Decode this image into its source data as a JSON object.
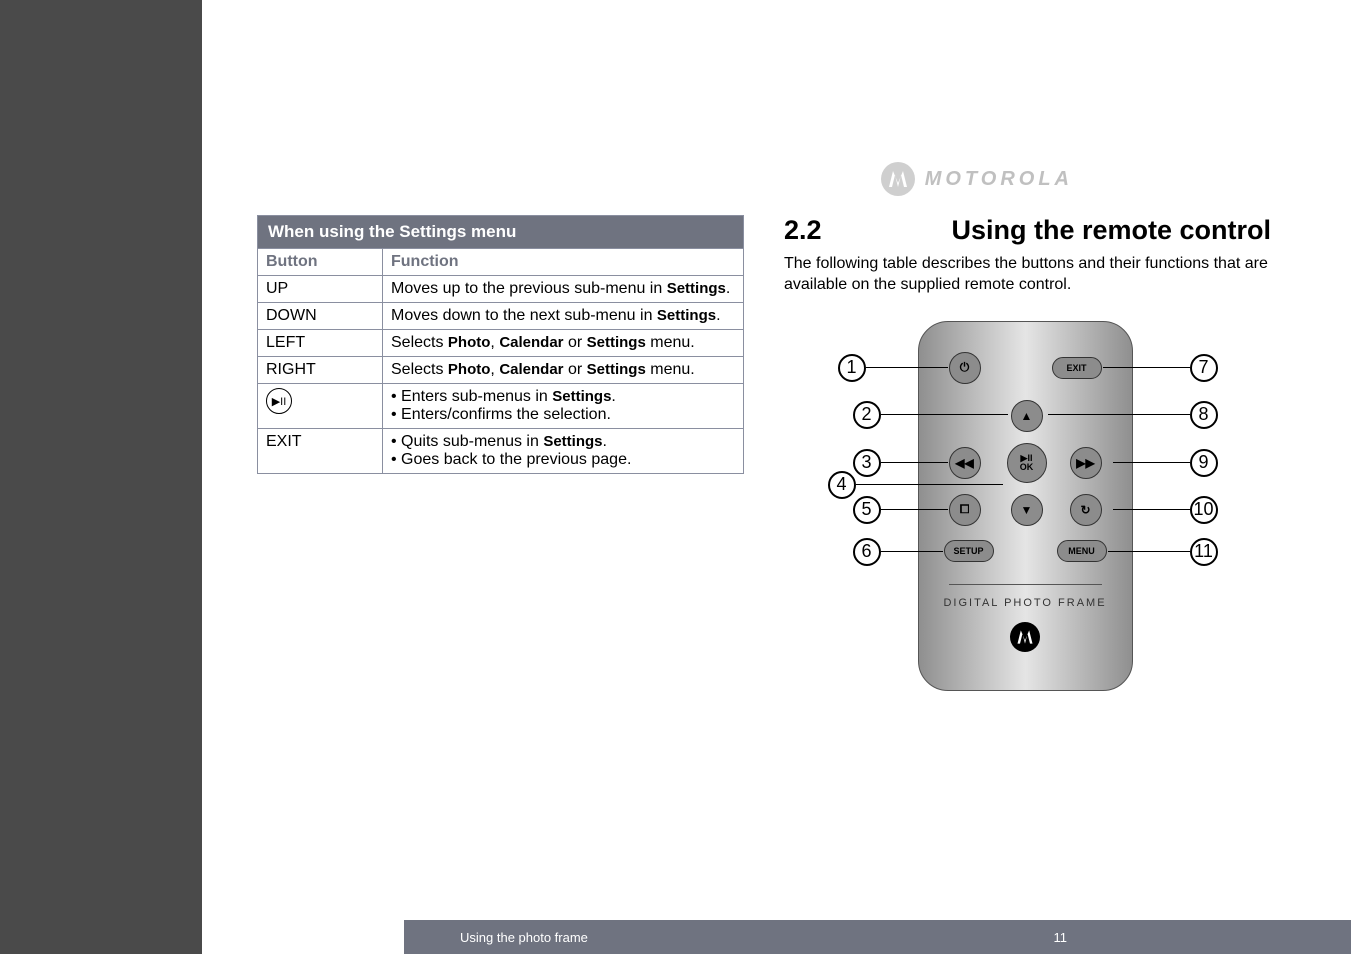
{
  "brand": "MOTOROLA",
  "header": {
    "section_number": "2.2",
    "section_title": "Using the remote control",
    "intro": "The following table describes the buttons and their functions that are available on the supplied remote control."
  },
  "table": {
    "title": "When using the Settings menu",
    "headers": {
      "button": "Button",
      "function": "Function"
    },
    "rows": [
      {
        "button": "UP",
        "function_parts": [
          "Moves up to the previous sub-menu in ",
          "Settings",
          "."
        ]
      },
      {
        "button": "DOWN",
        "function_parts": [
          "Moves down to the next sub-menu in ",
          "Settings",
          "."
        ]
      },
      {
        "button": "LEFT",
        "function_parts": [
          "Selects ",
          "Photo",
          ", ",
          "Calendar",
          " or ",
          "Settings",
          " menu."
        ]
      },
      {
        "button": "RIGHT",
        "function_parts": [
          "Selects ",
          "Photo",
          ", ",
          "Calendar",
          " or ",
          "Settings",
          " menu."
        ]
      },
      {
        "button": "▶II",
        "is_icon": true,
        "bullets": [
          [
            "Enters sub-menus in ",
            "Settings",
            "."
          ],
          [
            "Enters/confirms the selection."
          ]
        ]
      },
      {
        "button": "EXIT",
        "bullets": [
          [
            "Quits sub-menus in ",
            "Settings",
            "."
          ],
          [
            "Goes back to the previous page."
          ]
        ]
      }
    ]
  },
  "remote": {
    "label": "DIGITAL  PHOTO  FRAME",
    "callouts": {
      "left": [
        "1",
        "2",
        "3",
        "4",
        "5",
        "6"
      ],
      "right": [
        "7",
        "8",
        "9",
        "10",
        "11"
      ]
    },
    "buttons": {
      "power": "⏻",
      "exit": "EXIT",
      "up": "▲",
      "down": "▼",
      "rew": "◀◀",
      "fwd": "▶▶",
      "ok": "▶II OK",
      "stop": "⧠",
      "rotate": "↻",
      "setup": "SETUP",
      "menu": "MENU"
    }
  },
  "footer": {
    "chapter": "Using the photo frame",
    "page_number": "11"
  }
}
